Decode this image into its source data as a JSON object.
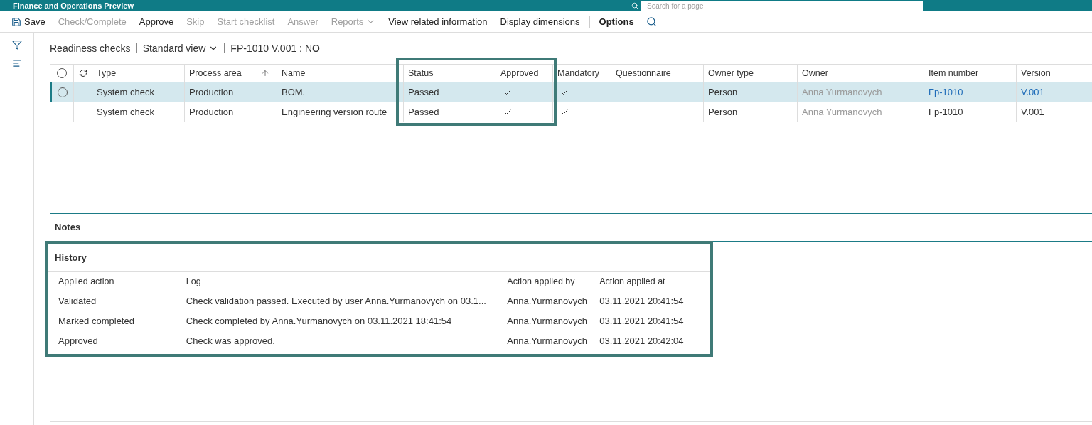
{
  "app_bar": {
    "title": "Finance and Operations Preview",
    "search": {
      "placeholder": "Search for a page"
    }
  },
  "toolbar": [
    {
      "label": "Save",
      "disabled": false,
      "dropdown": false,
      "active": false,
      "kind": "save"
    },
    {
      "label": "Check/Complete",
      "disabled": true,
      "dropdown": false,
      "active": false,
      "kind": "action"
    },
    {
      "label": "Approve",
      "disabled": false,
      "dropdown": false,
      "active": false,
      "kind": "action"
    },
    {
      "label": "Skip",
      "disabled": true,
      "dropdown": false,
      "active": false,
      "kind": "action"
    },
    {
      "label": "Start checklist",
      "disabled": true,
      "dropdown": false,
      "active": false,
      "kind": "action"
    },
    {
      "label": "Answer",
      "disabled": true,
      "dropdown": false,
      "active": false,
      "kind": "action"
    },
    {
      "label": "Reports",
      "disabled": true,
      "dropdown": true,
      "active": false,
      "kind": "action"
    },
    {
      "label": "View related information",
      "disabled": false,
      "dropdown": false,
      "active": false,
      "kind": "action"
    },
    {
      "label": "Display dimensions",
      "disabled": false,
      "dropdown": false,
      "active": false,
      "kind": "action"
    },
    {
      "label": "Options",
      "disabled": false,
      "dropdown": false,
      "active": true,
      "kind": "tab"
    }
  ],
  "breadcrumb": {
    "page": "Readiness checks",
    "view": "Standard view",
    "record": "FP-1010 V.001 : NO"
  },
  "grid": {
    "select_all": {
      "checked": false
    },
    "columns": [
      {
        "label": "Type",
        "sorted": false
      },
      {
        "label": "Process area",
        "sorted": true
      },
      {
        "label": "Name",
        "sorted": false
      },
      {
        "label": "Status",
        "sorted": false
      },
      {
        "label": "Approved",
        "sorted": false
      },
      {
        "label": "Mandatory",
        "sorted": false
      },
      {
        "label": "Questionnaire",
        "sorted": false
      },
      {
        "label": "Owner type",
        "sorted": false
      },
      {
        "label": "Owner",
        "sorted": false
      },
      {
        "label": "Item number",
        "sorted": false
      },
      {
        "label": "Version",
        "sorted": false
      }
    ],
    "rows": [
      {
        "selected": true,
        "type": "System check",
        "process_area": "Production",
        "name": "BOM.",
        "status": "Passed",
        "approved": true,
        "mandatory": true,
        "owner_type": "Person",
        "owner": "Anna Yurmanovych",
        "item_number": "Fp-1010",
        "version": "V.001"
      },
      {
        "selected": false,
        "type": "System check",
        "process_area": "Production",
        "name": "Engineering version route",
        "status": "Passed",
        "approved": true,
        "mandatory": true,
        "owner_type": "Person",
        "owner": "Anna Yurmanovych",
        "item_number": "Fp-1010",
        "version": "V.001"
      }
    ]
  },
  "notes": {
    "title": "Notes"
  },
  "history": {
    "title": "History",
    "columns": [
      "Applied action",
      "Log",
      "Action applied by",
      "Action applied at"
    ],
    "rows": [
      [
        "Validated",
        "Check validation passed. Executed by user Anna.Yurmanovych on 03.1...",
        "Anna.Yurmanovych",
        "03.11.2021 20:41:54"
      ],
      [
        "Marked completed",
        "Check completed by Anna.Yurmanovych on 03.11.2021 18:41:54",
        "Anna.Yurmanovych",
        "03.11.2021 20:41:54"
      ],
      [
        "Approved",
        "Check was approved.",
        "Anna.Yurmanovych",
        "03.11.2021 20:42:04"
      ]
    ]
  }
}
